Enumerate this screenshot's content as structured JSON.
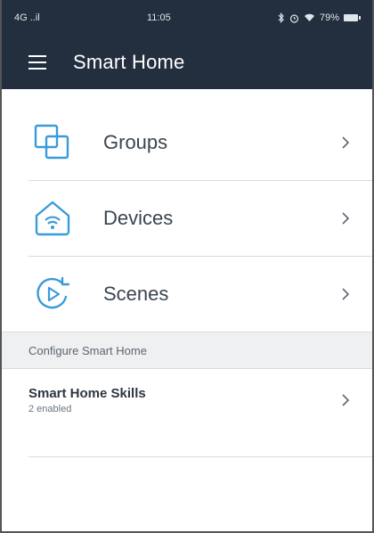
{
  "status_bar": {
    "signal": "4G ..il",
    "time": "11:05",
    "battery_pct": "79%",
    "indicators": [
      "bluetooth-icon",
      "alarm-icon",
      "wifi-icon"
    ]
  },
  "app_bar": {
    "title": "Smart Home",
    "menu_icon": "hamburger-menu-icon"
  },
  "menu": {
    "items": [
      {
        "label": "Groups",
        "icon": "groups-icon"
      },
      {
        "label": "Devices",
        "icon": "devices-icon"
      },
      {
        "label": "Scenes",
        "icon": "scenes-icon"
      }
    ]
  },
  "configure": {
    "header": "Configure Smart Home",
    "skills": {
      "title": "Smart Home Skills",
      "subtitle": "2 enabled"
    }
  },
  "colors": {
    "app_bar": "#232f3e",
    "accent": "#3a9bd9",
    "text": "#3a4450",
    "section_bg": "#eef0f2"
  }
}
